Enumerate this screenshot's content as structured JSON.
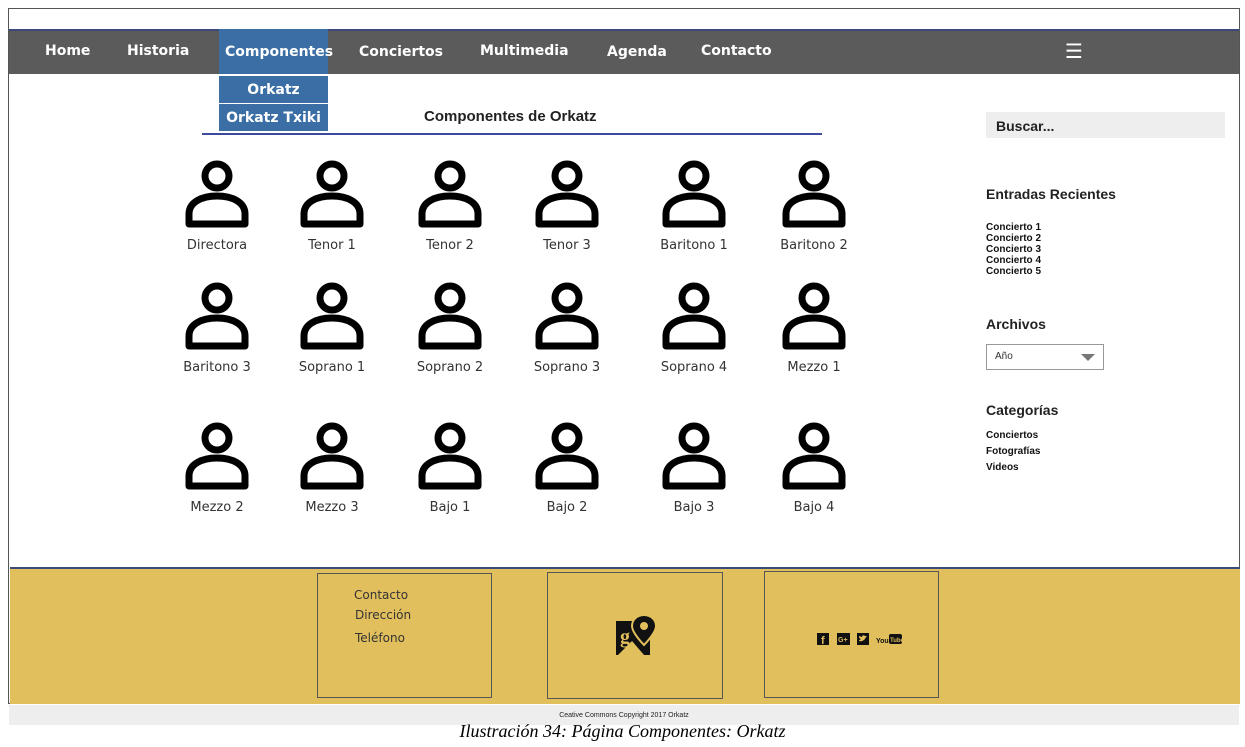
{
  "nav": {
    "items": [
      "Home",
      "Historia",
      "Componentes",
      "Conciertos",
      "Multimedia",
      "Agenda",
      "Contacto"
    ],
    "active": "Componentes",
    "menu_icon": "hamburger-icon",
    "menu_glyph": "☰"
  },
  "dropdown": {
    "items": [
      "Orkatz",
      "Orkatz Txiki"
    ]
  },
  "main": {
    "title": "Componentes de Orkatz",
    "members": [
      "Directora",
      "Tenor 1",
      "Tenor 2",
      "Tenor 3",
      "Baritono 1",
      "Baritono 2",
      "Baritono 3",
      "Soprano 1",
      "Soprano 2",
      "Soprano 3",
      "Soprano 4",
      "Mezzo 1",
      "Mezzo 2",
      "Mezzo 3",
      "Bajo 1",
      "Bajo 2",
      "Bajo 3",
      "Bajo 4"
    ],
    "member_icon": "person-icon"
  },
  "sidebar": {
    "search_label": "Buscar...",
    "recent_heading": "Entradas Recientes",
    "recent": [
      "Concierto 1",
      "Concierto 2",
      "Concierto 3",
      "Concierto 4",
      "Concierto 5"
    ],
    "archives_heading": "Archivos",
    "archives_select": "Año",
    "categories_heading": "Categorías",
    "categories": [
      "Conciertos",
      "Fotografías",
      "Videos"
    ]
  },
  "footer": {
    "contact": [
      "Contacto",
      "Dirección",
      "Teléfono"
    ],
    "map_icon": "google-maps-icon",
    "social_icons": [
      "facebook-icon",
      "google-plus-icon",
      "twitter-icon",
      "youtube-icon"
    ],
    "copyright": "Ceative Commons Copyright 2017 Orkatz"
  },
  "caption": "Ilustración 34: Página Componentes: Orkatz",
  "colors": {
    "nav_bg": "#5b5b5b",
    "active": "#3a6ea5",
    "footer_bg": "#e2bf5d",
    "accent_line": "#3b4a9c"
  }
}
